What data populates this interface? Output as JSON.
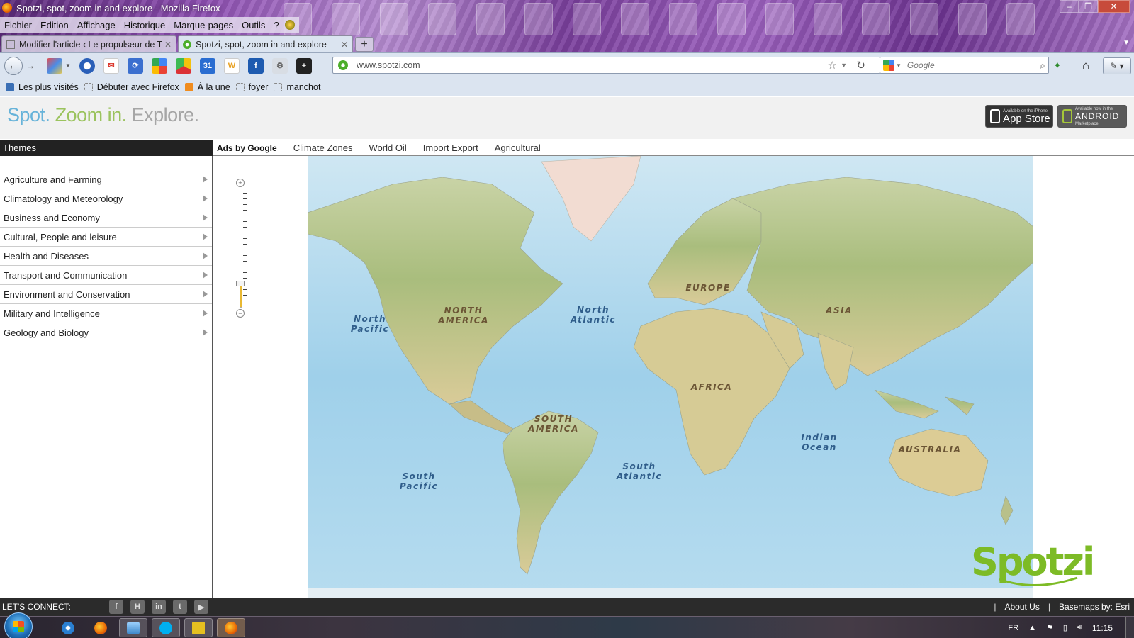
{
  "window": {
    "title": "Spotzi, spot, zoom in and explore - Mozilla Firefox",
    "controls": [
      "–",
      "❐",
      "✕"
    ]
  },
  "menu": [
    "Fichier",
    "Edition",
    "Affichage",
    "Historique",
    "Marque-pages",
    "Outils",
    "?"
  ],
  "tabs": [
    {
      "label": "Modifier l'article ‹ Le propulseur de Ti...",
      "close": "✕"
    },
    {
      "label": "Spotzi, spot, zoom in and explore",
      "close": "✕"
    }
  ],
  "new_tab_label": "+",
  "toolbar": {
    "url": "www.spotzi.com",
    "search_placeholder": "Google",
    "calendar_icon_text": "31",
    "icons": [
      "back-icon",
      "forward-icon",
      "color-icon",
      "opera-icon",
      "gmail-icon",
      "sync-icon",
      "google-icon",
      "picasa-icon",
      "calendar-icon",
      "wiki-icon",
      "facebook-icon",
      "gear-icon",
      "plus-icon"
    ]
  },
  "bookmarks": [
    "Les plus visités",
    "Débuter avec Firefox",
    "À la une",
    "foyer",
    "manchot"
  ],
  "site": {
    "tagline": {
      "part1": "Spot.",
      "part2": "Zoom in.",
      "part3": "Explore."
    },
    "app_store": {
      "small": "Available on the iPhone",
      "big": "App Store"
    },
    "android": {
      "small": "Available now in the",
      "big": "ANDROID",
      "sub": "Marketplace"
    },
    "themes_header": "Themes",
    "ads_label": "Ads by Google",
    "theme_tabs": [
      "Climate Zones",
      "World Oil",
      "Import Export",
      "Agricultural"
    ],
    "sidebar_items": [
      "Agriculture and Farming",
      "Climatology and Meteorology",
      "Business and Economy",
      "Cultural, People and leisure",
      "Health and Diseases",
      "Transport and Communication",
      "Environment and Conservation",
      "Military and Intelligence",
      "Geology and Biology"
    ],
    "zoom_level_fraction": 0.2,
    "map_labels": {
      "north_america": [
        "NORTH",
        "AMERICA"
      ],
      "south_america": [
        "SOUTH",
        "AMERICA"
      ],
      "europe": [
        "EUROPE"
      ],
      "asia": [
        "ASIA"
      ],
      "africa": [
        "AFRICA"
      ],
      "australia": [
        "AUSTRALIA"
      ],
      "north_pacific": [
        "North",
        "Pacific"
      ],
      "north_atlantic": [
        "North",
        "Atlantic"
      ],
      "south_pacific": [
        "South",
        "Pacific"
      ],
      "south_atlantic": [
        "South",
        "Atlantic"
      ],
      "indian_ocean": [
        "Indian",
        "Ocean"
      ]
    },
    "logo_text": "Spotzi",
    "footer": {
      "lets_connect": "LET'S CONNECT:",
      "social": [
        {
          "name": "facebook-icon",
          "glyph": "f"
        },
        {
          "name": "hyves-icon",
          "glyph": "H"
        },
        {
          "name": "linkedin-icon",
          "glyph": "in"
        },
        {
          "name": "twitter-icon",
          "glyph": "t"
        },
        {
          "name": "youtube-icon",
          "glyph": "▶"
        }
      ],
      "separator": "|",
      "about": "About Us",
      "basemaps": "Basemaps by: Esri"
    }
  },
  "taskbar": {
    "language": "FR",
    "clock": "11:15"
  },
  "colors": {
    "tagline_blue": "#67b3d9",
    "tagline_green": "#9bc35e",
    "tagline_gray": "#a6a6a6",
    "logo_green": "#7dbb26",
    "ocean": "#a9d6ec",
    "land": "#d8cd9c"
  }
}
